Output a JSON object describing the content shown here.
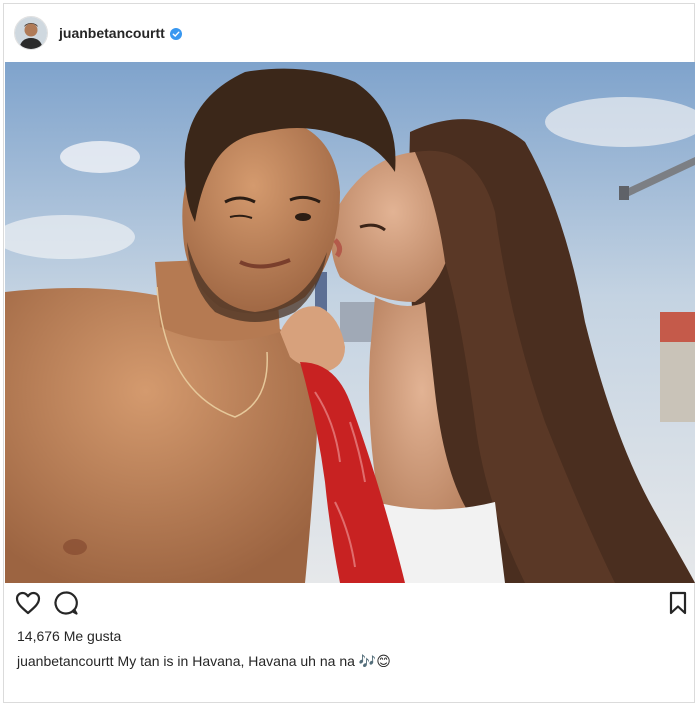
{
  "post": {
    "username": "juanbetancourtt",
    "verified": true,
    "likes_text": "14,676 Me gusta",
    "caption_user": "juanbetancourtt",
    "caption_text": "My tan is in Havana, Havana uh na na 🎶😊"
  },
  "actions": {
    "like_icon": "heart-icon",
    "comment_icon": "comment-icon",
    "save_icon": "bookmark-icon"
  },
  "colors": {
    "text": "#262626",
    "verified_badge": "#3897f0",
    "border": "#dbdbdb"
  }
}
